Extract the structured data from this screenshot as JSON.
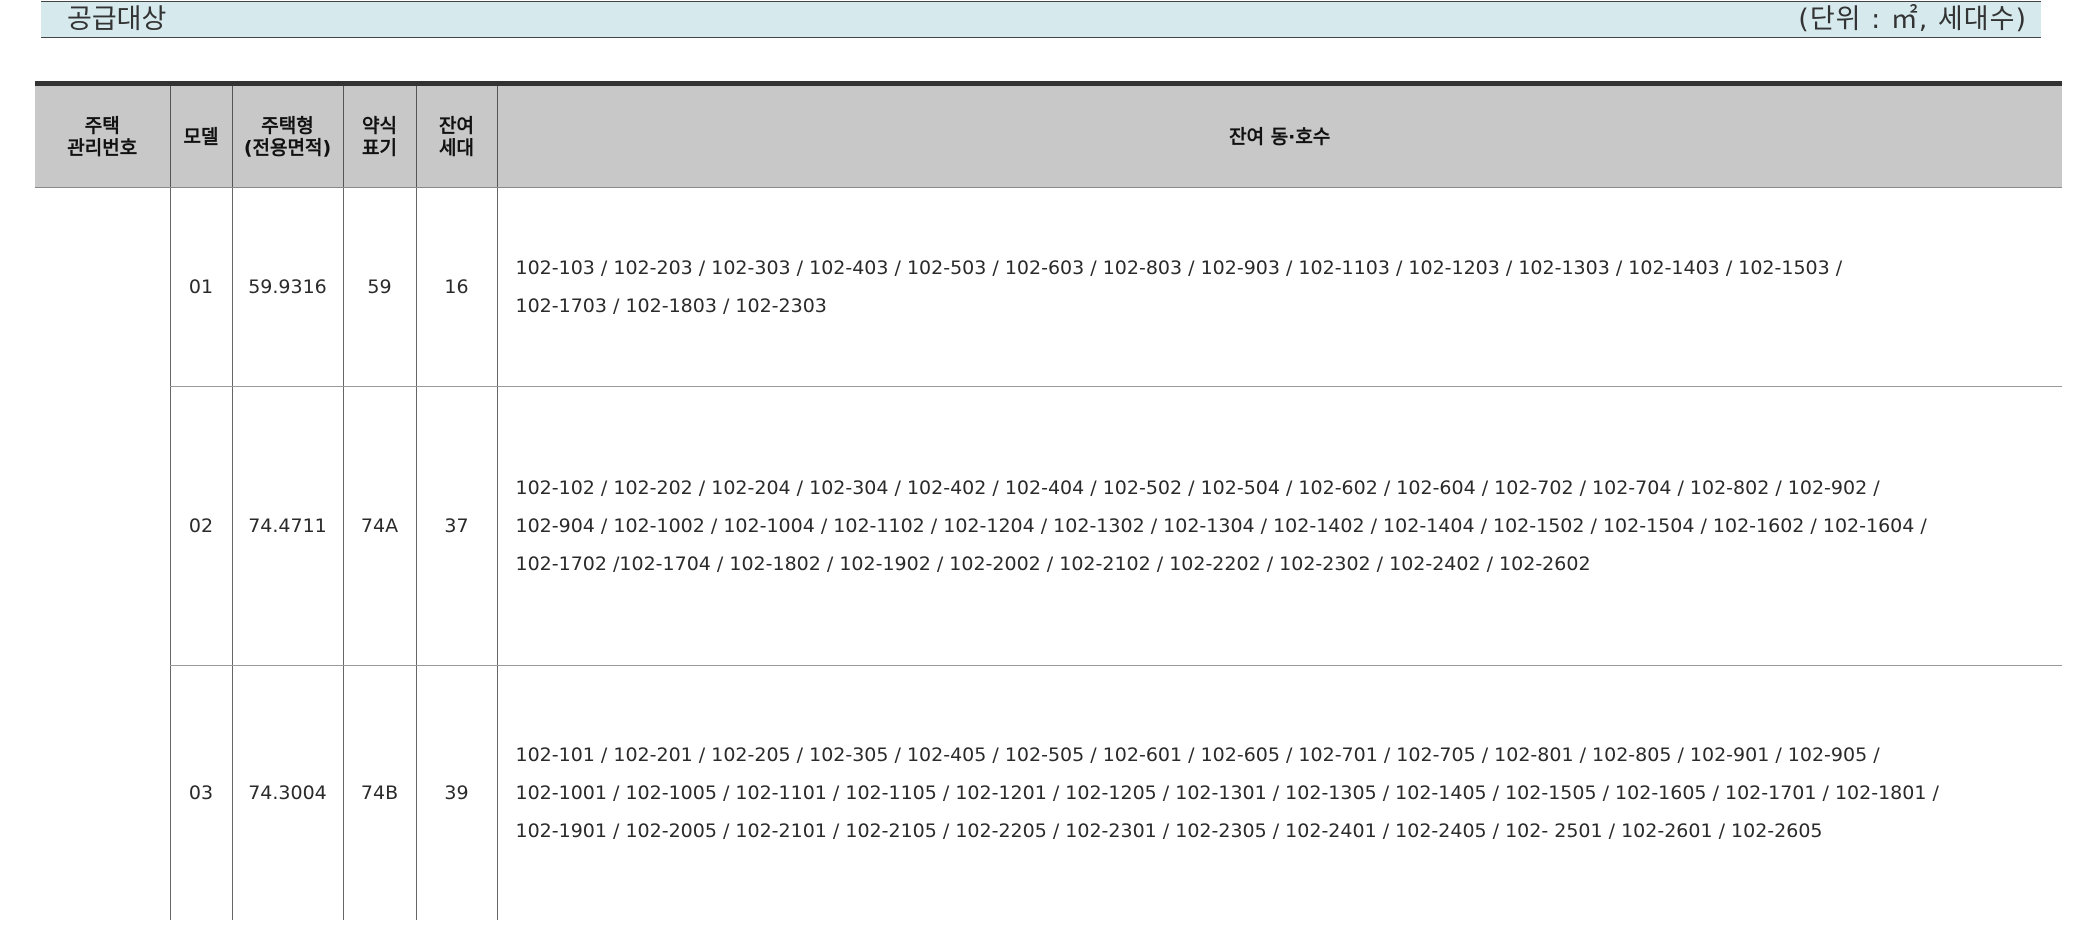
{
  "header": {
    "title": "공급대상",
    "unit": "(단위 : ㎡, 세대수)"
  },
  "table": {
    "columns": [
      {
        "line1": "주택",
        "line2": "관리번호"
      },
      {
        "line1": "모델",
        "line2": ""
      },
      {
        "line1": "주택형",
        "line2": "(전용면적)"
      },
      {
        "line1": "약식",
        "line2": "표기"
      },
      {
        "line1": "잔여",
        "line2": "세대"
      },
      {
        "line1": "잔여 동·호수",
        "line2": ""
      }
    ],
    "mgmt_no": "",
    "rows": [
      {
        "model": "01",
        "area": "59.9316",
        "abbr": "59",
        "remaining": "16",
        "units": [
          "102-103  /  102-203  /  102-303  /  102-403  /  102-503  /  102-603  /  102-803  /  102-903  /  102-1103  /  102-1203  /  102-1303  /  102-1403  /  102-1503  /",
          "102-1703  /  102-1803  /  102-2303"
        ]
      },
      {
        "model": "02",
        "area": "74.4711",
        "abbr": "74A",
        "remaining": "37",
        "units": [
          "102-102  /  102-202  /  102-204  /  102-304  /  102-402  /  102-404  /  102-502  /  102-504  /  102-602  /  102-604  /  102-702  /  102-704  /  102-802  /  102-902  /",
          "102-904  /  102-1002  /  102-1004  /  102-1102  /  102-1204  /  102-1302  /  102-1304  /  102-1402  /  102-1404  /  102-1502  /  102-1504  /  102-1602  /  102-1604  /",
          "102-1702  /102-1704  /  102-1802  /  102-1902  /  102-2002  /  102-2102  /  102-2202  /  102-2302  /  102-2402  /  102-2602"
        ]
      },
      {
        "model": "03",
        "area": "74.3004",
        "abbr": "74B",
        "remaining": "39",
        "units": [
          "102-101  /  102-201  /  102-205  /  102-305  /  102-405  /  102-505  /  102-601  /  102-605  /  102-701  /  102-705  /  102-801  /  102-805  /  102-901  /  102-905  /",
          "102-1001  /  102-1005  /  102-1101  /  102-1105  /  102-1201  /  102-1205  /  102-1301  /  102-1305  /  102-1405  /  102-1505  /  102-1605  /  102-1701  /  102-1801  /",
          "102-1901  /  102-2005  /  102-2101  /  102-2105  /  102-2205  /  102-2301  /  102-2305  /  102-2401  /  102-2405  /  102- 2501  /  102-2601  /  102-2605"
        ]
      }
    ]
  }
}
